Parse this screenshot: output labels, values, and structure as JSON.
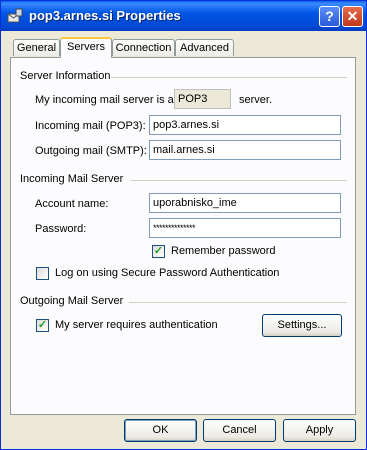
{
  "window": {
    "title": "pop3.arnes.si Properties",
    "help_label": "?",
    "close_label": "✕"
  },
  "tabs": [
    {
      "label": "General",
      "active": false
    },
    {
      "label": "Servers",
      "active": true
    },
    {
      "label": "Connection",
      "active": false
    },
    {
      "label": "Advanced",
      "active": false
    }
  ],
  "server_info": {
    "group_label": "Server Information",
    "incoming_type_prefix": "My incoming mail server is a",
    "incoming_type_value": "POP3",
    "incoming_type_suffix": "server.",
    "incoming_label": "Incoming mail (POP3):",
    "incoming_value": "pop3.arnes.si",
    "outgoing_label": "Outgoing mail (SMTP):",
    "outgoing_value": "mail.arnes.si"
  },
  "incoming_server": {
    "group_label": "Incoming Mail Server",
    "account_label": "Account name:",
    "account_value": "uporabnisko_ime",
    "password_label": "Password:",
    "password_value": "**************",
    "remember_label": "Remember password",
    "remember_checked": true,
    "spa_label": "Log on using Secure Password Authentication",
    "spa_checked": false
  },
  "outgoing_server": {
    "group_label": "Outgoing Mail Server",
    "auth_label": "My server requires authentication",
    "auth_checked": true,
    "settings_label": "Settings..."
  },
  "buttons": {
    "ok": "OK",
    "cancel": "Cancel",
    "apply": "Apply"
  },
  "colors": {
    "title_bar": "#0055e5",
    "tab_highlight": "#ffc83c",
    "dialog_bg": "#ece9d8"
  }
}
